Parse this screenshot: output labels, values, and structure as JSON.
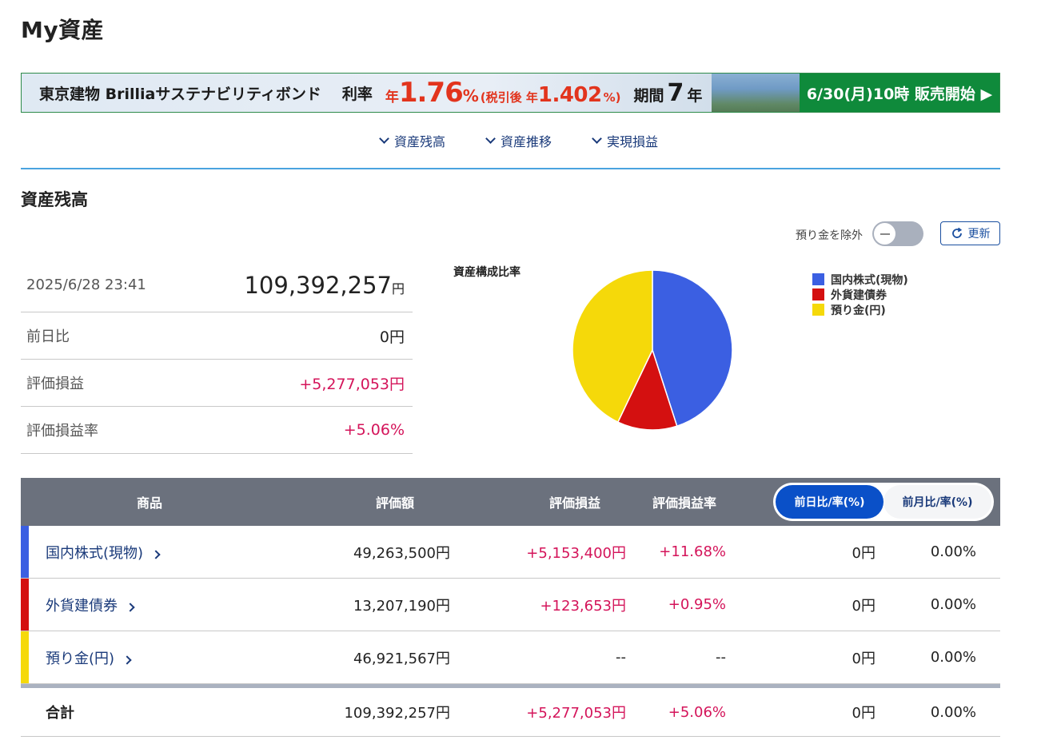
{
  "page": {
    "title": "My資産"
  },
  "banner": {
    "brand": "東京建物 Brilliaサステナビリティボンド",
    "rate_label": "利率",
    "rate_prefix": "年",
    "rate_value": "1.76",
    "rate_pct": "%",
    "after_tax_label": "(税引後 年",
    "after_tax_value": "1.402",
    "after_tax_close": "%)",
    "term_label": "期間",
    "term_value": "7",
    "term_unit": "年",
    "cta": "6/30(月)10時 販売開始 ▶"
  },
  "nav": {
    "items": [
      {
        "label": "資産残高"
      },
      {
        "label": "資産推移"
      },
      {
        "label": "実現損益"
      }
    ]
  },
  "section": {
    "title": "資産残高"
  },
  "controls": {
    "exclude_deposit_label": "預り金を除外",
    "exclude_deposit_on": false,
    "refresh_label": "更新"
  },
  "summary": {
    "datetime": "2025/6/28 23:41",
    "total": "109,392,257",
    "total_unit": "円",
    "rows": [
      {
        "label": "前日比",
        "value": "0円"
      },
      {
        "label": "評価損益",
        "value": "+5,277,053円"
      },
      {
        "label": "評価損益率",
        "value": "+5.06%"
      }
    ]
  },
  "chart_data": {
    "type": "pie",
    "title": "資産構成比率",
    "labels": [
      "国内株式(現物)",
      "外貨建債券",
      "預り金(円)"
    ],
    "values": [
      49263500,
      13207190,
      46921567
    ],
    "colors": [
      "#3b5fe2",
      "#d41010",
      "#f5d90a"
    ],
    "legend_position": "right"
  },
  "table": {
    "headers": {
      "product": "商品",
      "valuation": "評価額",
      "pl": "評価損益",
      "pl_rate": "評価損益率"
    },
    "toggle": {
      "day": "前日比/率(%)",
      "month": "前月比/率(%)",
      "active": "day"
    },
    "rows": [
      {
        "name": "国内株式(現物)",
        "valuation": "49,263,500円",
        "pl": "+5,153,400円",
        "pl_rate": "+11.68%",
        "change": "0円",
        "change_rate": "0.00%",
        "color": "#3b5fe2"
      },
      {
        "name": "外貨建債券",
        "valuation": "13,207,190円",
        "pl": "+123,653円",
        "pl_rate": "+0.95%",
        "change": "0円",
        "change_rate": "0.00%",
        "color": "#d41010"
      },
      {
        "name": "預り金(円)",
        "valuation": "46,921,567円",
        "pl": "--",
        "pl_rate": "--",
        "change": "0円",
        "change_rate": "0.00%",
        "color": "#f5d90a"
      }
    ],
    "total": {
      "label": "合計",
      "valuation": "109,392,257円",
      "pl": "+5,277,053円",
      "pl_rate": "+5.06%",
      "change": "0円",
      "change_rate": "0.00%"
    }
  }
}
